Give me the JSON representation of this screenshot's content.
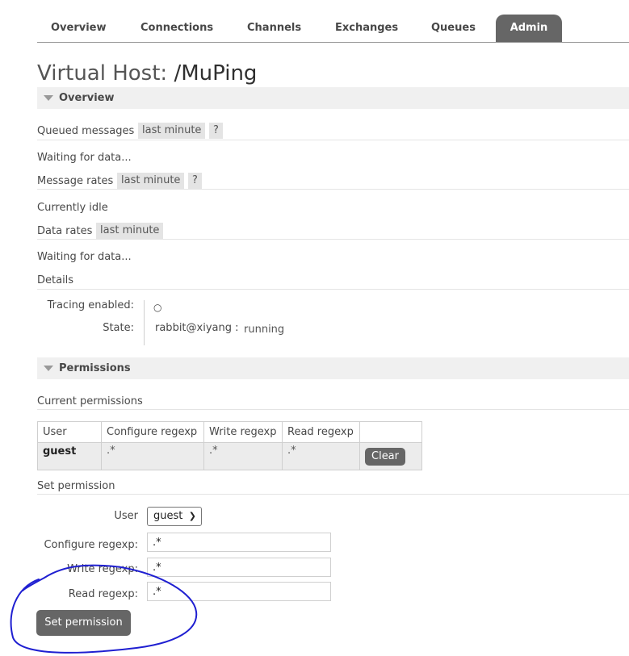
{
  "nav": {
    "tabs": [
      {
        "label": "Overview"
      },
      {
        "label": "Connections"
      },
      {
        "label": "Channels"
      },
      {
        "label": "Exchanges"
      },
      {
        "label": "Queues"
      },
      {
        "label": "Admin",
        "active": true
      }
    ]
  },
  "page": {
    "title_prefix": "Virtual Host:",
    "title_name": "/MuPing"
  },
  "overview": {
    "heading": "Overview",
    "queued_label": "Queued messages",
    "queued_range": "last minute",
    "help": "?",
    "queued_status": "Waiting for data...",
    "msg_rates_label": "Message rates",
    "msg_rates_range": "last minute",
    "msg_rates_status": "Currently idle",
    "data_rates_label": "Data rates",
    "data_rates_range": "last minute",
    "data_rates_status": "Waiting for data...",
    "details_label": "Details",
    "tracing_label": "Tracing enabled:",
    "tracing_value": "○",
    "state_label": "State:",
    "state_node": "rabbit@xiyang :",
    "state_value": "running"
  },
  "permissions": {
    "heading": "Permissions",
    "current_label": "Current permissions",
    "columns": [
      "User",
      "Configure regexp",
      "Write regexp",
      "Read regexp"
    ],
    "rows": [
      {
        "user": "guest",
        "configure": ".*",
        "write": ".*",
        "read": ".*",
        "action": "Clear"
      }
    ],
    "set_label": "Set permission",
    "form": {
      "user_label": "User",
      "user_selected": "guest",
      "configure_label": "Configure regexp:",
      "configure_value": ".*",
      "write_label": "Write regexp:",
      "write_value": ".*",
      "read_label": "Read regexp:",
      "read_value": ".*",
      "submit_label": "Set permission"
    }
  },
  "colors": {
    "active_tab": "#666666",
    "annotation": "#1f1fd1"
  }
}
